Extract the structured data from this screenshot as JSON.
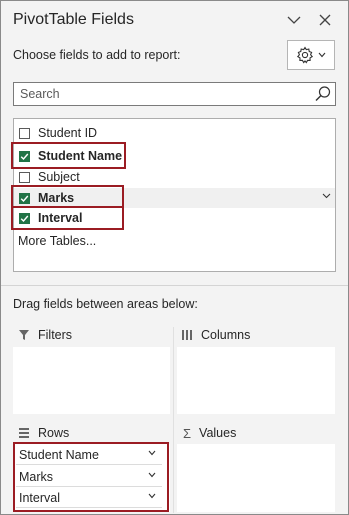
{
  "header": {
    "title": "PivotTable Fields",
    "collapse_icon": "chevron-down-icon",
    "close_icon": "close-icon"
  },
  "toolbar": {
    "instruction": "Choose fields to add to report:",
    "settings_icon": "gear-icon"
  },
  "search": {
    "placeholder": "Search",
    "icon": "search-icon"
  },
  "fields": [
    {
      "label": "Student ID",
      "checked": false,
      "bold": false
    },
    {
      "label": "Student Name",
      "checked": true,
      "bold": true
    },
    {
      "label": "Subject",
      "checked": false,
      "bold": false
    },
    {
      "label": "Marks",
      "checked": true,
      "bold": true
    },
    {
      "label": "Interval",
      "checked": true,
      "bold": true
    }
  ],
  "more_tables": "More Tables...",
  "areas_label": "Drag fields between areas below:",
  "areas": {
    "filters": {
      "label": "Filters",
      "icon": "filter-icon"
    },
    "columns": {
      "label": "Columns",
      "icon": "columns-icon"
    },
    "rows": {
      "label": "Rows",
      "icon": "rows-icon",
      "items": [
        "Student Name",
        "Marks",
        "Interval"
      ]
    },
    "values": {
      "label": "Values",
      "icon": "sigma-icon"
    }
  },
  "colors": {
    "checkbox_checked": "#217346",
    "highlight_border": "#9b1c23"
  }
}
